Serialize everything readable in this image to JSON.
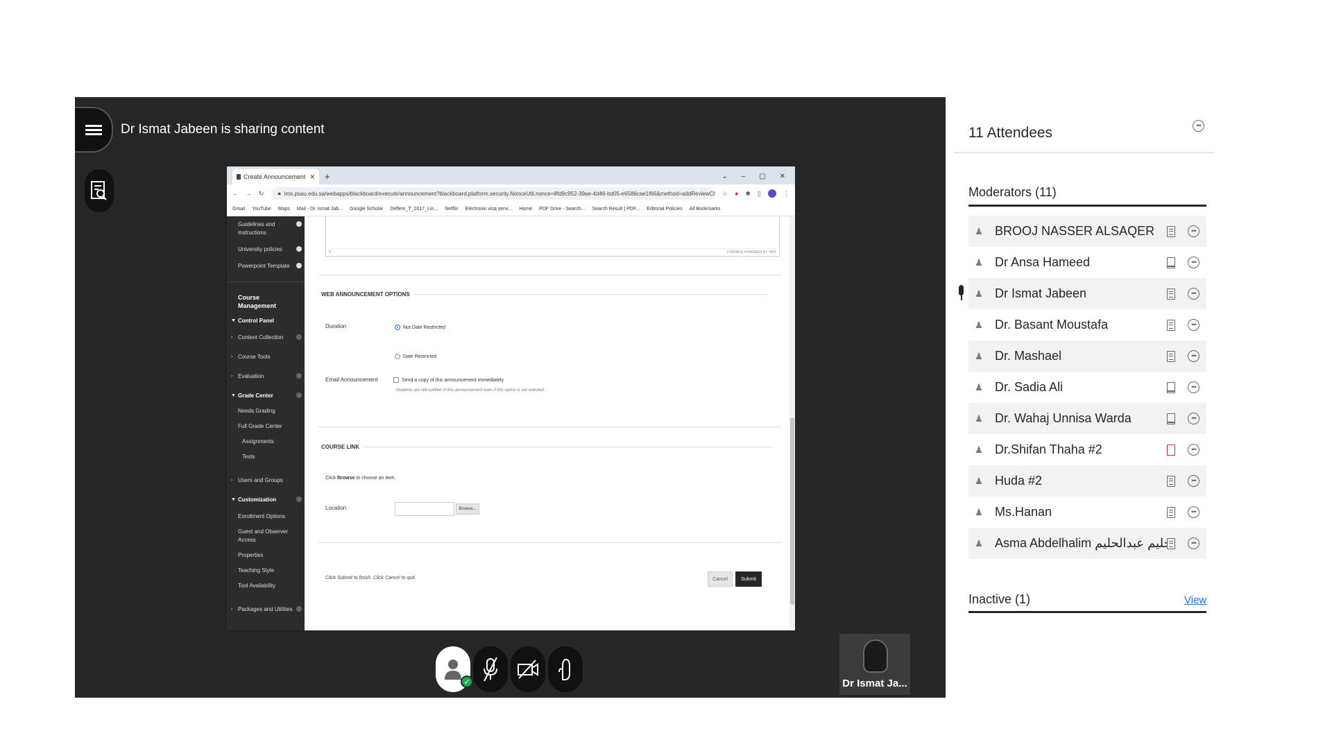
{
  "session": {
    "sharing_status": "Dr Ismat Jabeen is sharing content",
    "presenter_tile_name": "Dr Ismat Ja..."
  },
  "browser": {
    "tab_title": "Create Announcement – لاتصال",
    "url": "lms.psau.edu.sa/webapps/blackboard/execute/announcement?blackboard.platform.security.NonceUtil.nonce=8fd9c952-39ae-4d46-bd05-e6586cae1f66&method=addReviewChoic...",
    "bookmarks": [
      "Gmail",
      "YouTube",
      "Maps",
      "Mail - Dr. Ismat Jab...",
      "Google Scholar",
      "Deflem_T_2017_Lin...",
      "Netflix",
      "Electronic visa servi...",
      "Home",
      "PDF Drive - Search...",
      "Search Result | PDF...",
      "Editorial Policies",
      "All Bookmarks"
    ]
  },
  "lms": {
    "sidebar_top": [
      "Guidelines and Instructions",
      "University policies",
      "Powerpoint Template"
    ],
    "course_management": "Course Management",
    "control_panel": "Control Panel",
    "sidebar_items": [
      "Content Collection",
      "Course Tools",
      "Evaluation"
    ],
    "grade_center": "Grade Center",
    "grade_items": [
      "Needs Grading",
      "Full Grade Center",
      "Assignments",
      "Tests"
    ],
    "users_groups": "Users and Groups",
    "customization": "Customization",
    "custom_items": [
      "Enrollment Options",
      "Guest and Observer Access",
      "Properties",
      "Teaching Style",
      "Tool Availability"
    ],
    "packages": "Packages and Utilities",
    "editor_footer": "0 WORDS  POWERED BY TINY",
    "editor_path": "P",
    "web_options_title": "WEB ANNOUNCEMENT OPTIONS",
    "duration_label": "Duration",
    "not_date_restricted": "Not Date Restricted",
    "date_restricted": "Date Restricted",
    "email_label": "Email Announcement",
    "email_checkbox": "Send a copy of this announcement immediately",
    "email_hint": "Students are still notified of this announcement even if this option is not selected.",
    "course_link_title": "COURSE LINK",
    "browse_hint_pre": "Click ",
    "browse_hint_bold": "Browse",
    "browse_hint_post": " to choose an item.",
    "location_label": "Location",
    "browse_button": "Browse...",
    "footer_hint": "Click Submit to finish. Click Cancel to quit.",
    "cancel_button": "Cancel",
    "submit_button": "Submit"
  },
  "panel": {
    "attendees_title": "11 Attendees",
    "moderators_title": "Moderators (11)",
    "attendees": [
      {
        "name": "BROOJ NASSER ALSAQER",
        "device": "lines"
      },
      {
        "name": "Dr Ansa Hameed",
        "device": "base"
      },
      {
        "name": "Dr Ismat Jabeen",
        "device": "lines"
      },
      {
        "name": "Dr. Basant Moustafa",
        "device": "lines"
      },
      {
        "name": "Dr. Mashael",
        "device": "lines"
      },
      {
        "name": "Dr. Sadia Ali",
        "device": "base"
      },
      {
        "name": "Dr. Wahaj Unnisa Warda",
        "device": "base"
      },
      {
        "name": "Dr.Shifan Thaha #2",
        "device": "red"
      },
      {
        "name": "Huda #2",
        "device": "lines"
      },
      {
        "name": "Ms.Hanan",
        "device": "lines"
      },
      {
        "name": "Asma Abdelhalim اسماء عبدالحليم عبدالحليم",
        "device": "lines"
      }
    ],
    "inactive_title": "Inactive (1)",
    "view_link": "View"
  },
  "colors": {
    "stage_bg": "#262626",
    "accent_link": "#2a6fd6",
    "status_green": "#19a854",
    "alert_red": "#e0262c"
  }
}
